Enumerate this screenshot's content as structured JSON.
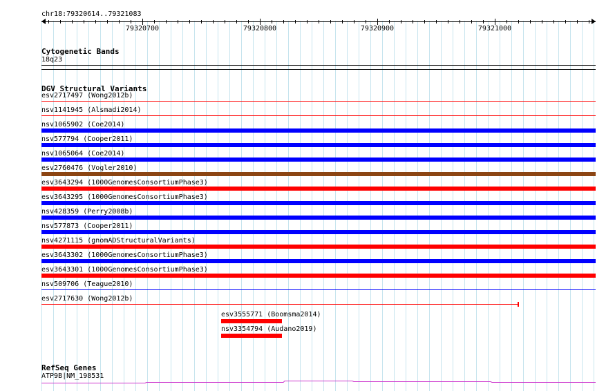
{
  "location": "chr18:79320614..79321083",
  "ruler": {
    "ticks": [
      "79320700",
      "79320800",
      "79320900",
      "79321000"
    ]
  },
  "tracks": {
    "cytoband": {
      "title": "Cytogenetic Bands",
      "band": "18q23"
    },
    "dgv": {
      "title": "DGV Structural Variants",
      "features": [
        {
          "id": "esv2717497",
          "source": "(Wong2012b)",
          "style": "thin",
          "color": "#ff0000"
        },
        {
          "id": "nsv1141945",
          "source": "(Alsmadi2014)",
          "style": "thin",
          "color": "#ff0000"
        },
        {
          "id": "nsv1065902",
          "source": "(Coe2014)",
          "style": "thick",
          "color": "#0000ff"
        },
        {
          "id": "nsv577794",
          "source": "(Cooper2011)",
          "style": "thick",
          "color": "#0000ff"
        },
        {
          "id": "nsv1065064",
          "source": "(Coe2014)",
          "style": "thick",
          "color": "#0000ff"
        },
        {
          "id": "esv2760476",
          "source": "(Vogler2010)",
          "style": "thick",
          "color": "#8b4513"
        },
        {
          "id": "esv3643294",
          "source": "(1000GenomesConsortiumPhase3)",
          "style": "thick",
          "color": "#ff0000"
        },
        {
          "id": "esv3643295",
          "source": "(1000GenomesConsortiumPhase3)",
          "style": "thick",
          "color": "#0000ff"
        },
        {
          "id": "nsv428359",
          "source": "(Perry2008b)",
          "style": "thick",
          "color": "#0000ff"
        },
        {
          "id": "nsv577873",
          "source": "(Cooper2011)",
          "style": "thick",
          "color": "#0000ff"
        },
        {
          "id": "nsv4271115",
          "source": "(gnomADStructuralVariants)",
          "style": "thick",
          "color": "#ff0000"
        },
        {
          "id": "esv3643302",
          "source": "(1000GenomesConsortiumPhase3)",
          "style": "thick",
          "color": "#0000ff"
        },
        {
          "id": "esv3643301",
          "source": "(1000GenomesConsortiumPhase3)",
          "style": "thick",
          "color": "#ff0000"
        },
        {
          "id": "nsv509706",
          "source": "(Teague2010)",
          "style": "thin",
          "color": "#0000ff"
        },
        {
          "id": "esv2717630",
          "source": "(Wong2012b)",
          "style": "thin-end",
          "color": "#ff0000"
        }
      ],
      "short_features": [
        {
          "id": "esv3555771",
          "source": "(Boomsma2014)",
          "color": "#ff0000"
        },
        {
          "id": "nsv3354794",
          "source": "(Audano2019)",
          "color": "#ff0000"
        }
      ]
    },
    "refseq": {
      "title": "RefSeq Genes",
      "gene": "ATP9B|NM_198531",
      "color": "#cc33cc"
    }
  }
}
